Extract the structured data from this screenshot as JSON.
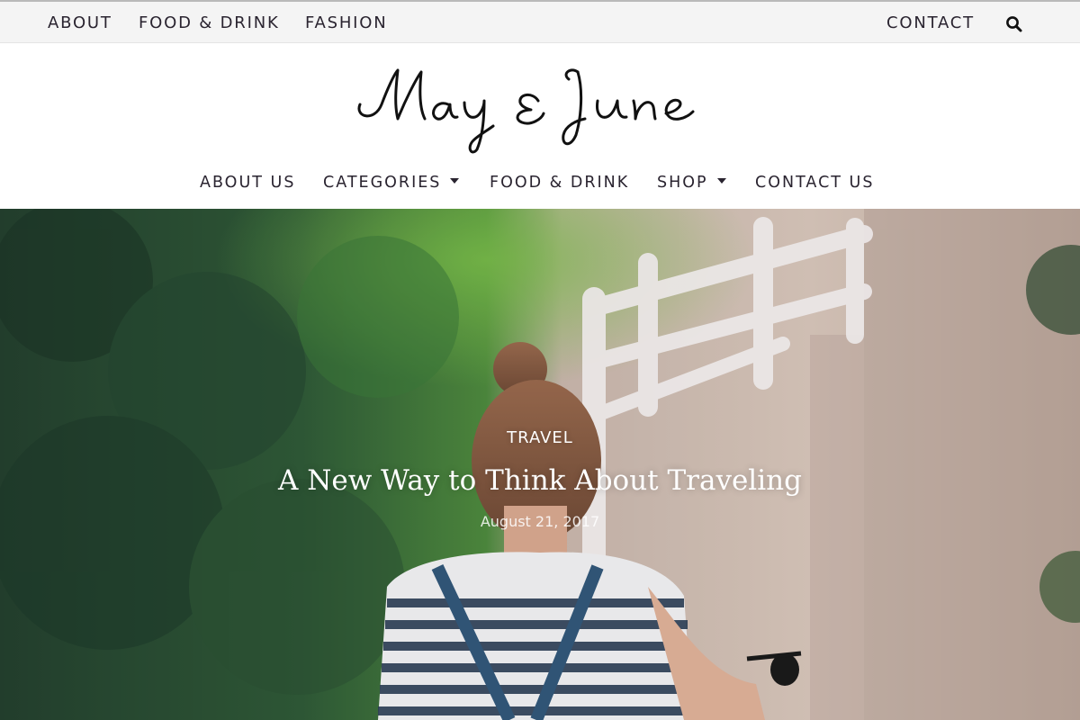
{
  "topbar": {
    "left_links": [
      "ABOUT",
      "FOOD & DRINK",
      "FASHION"
    ],
    "right_link": "CONTACT",
    "search_icon": "search-icon"
  },
  "logo": {
    "text": "May & June"
  },
  "mainnav": {
    "items": [
      {
        "label": "ABOUT US"
      },
      {
        "label": "CATEGORIES",
        "dropdown_icon": "caret-down-icon"
      },
      {
        "label": "FOOD & DRINK"
      },
      {
        "label": "SHOP",
        "dropdown_icon": "caret-down-icon"
      },
      {
        "label": "CONTACT US"
      }
    ]
  },
  "hero": {
    "category": "TRAVEL",
    "title": "A New Way to Think About Traveling",
    "date": "August 21, 2017"
  },
  "colors": {
    "topbar_bg": "#f4f4f4",
    "nav_text": "#2a2430",
    "hero_text": "#ffffff"
  }
}
